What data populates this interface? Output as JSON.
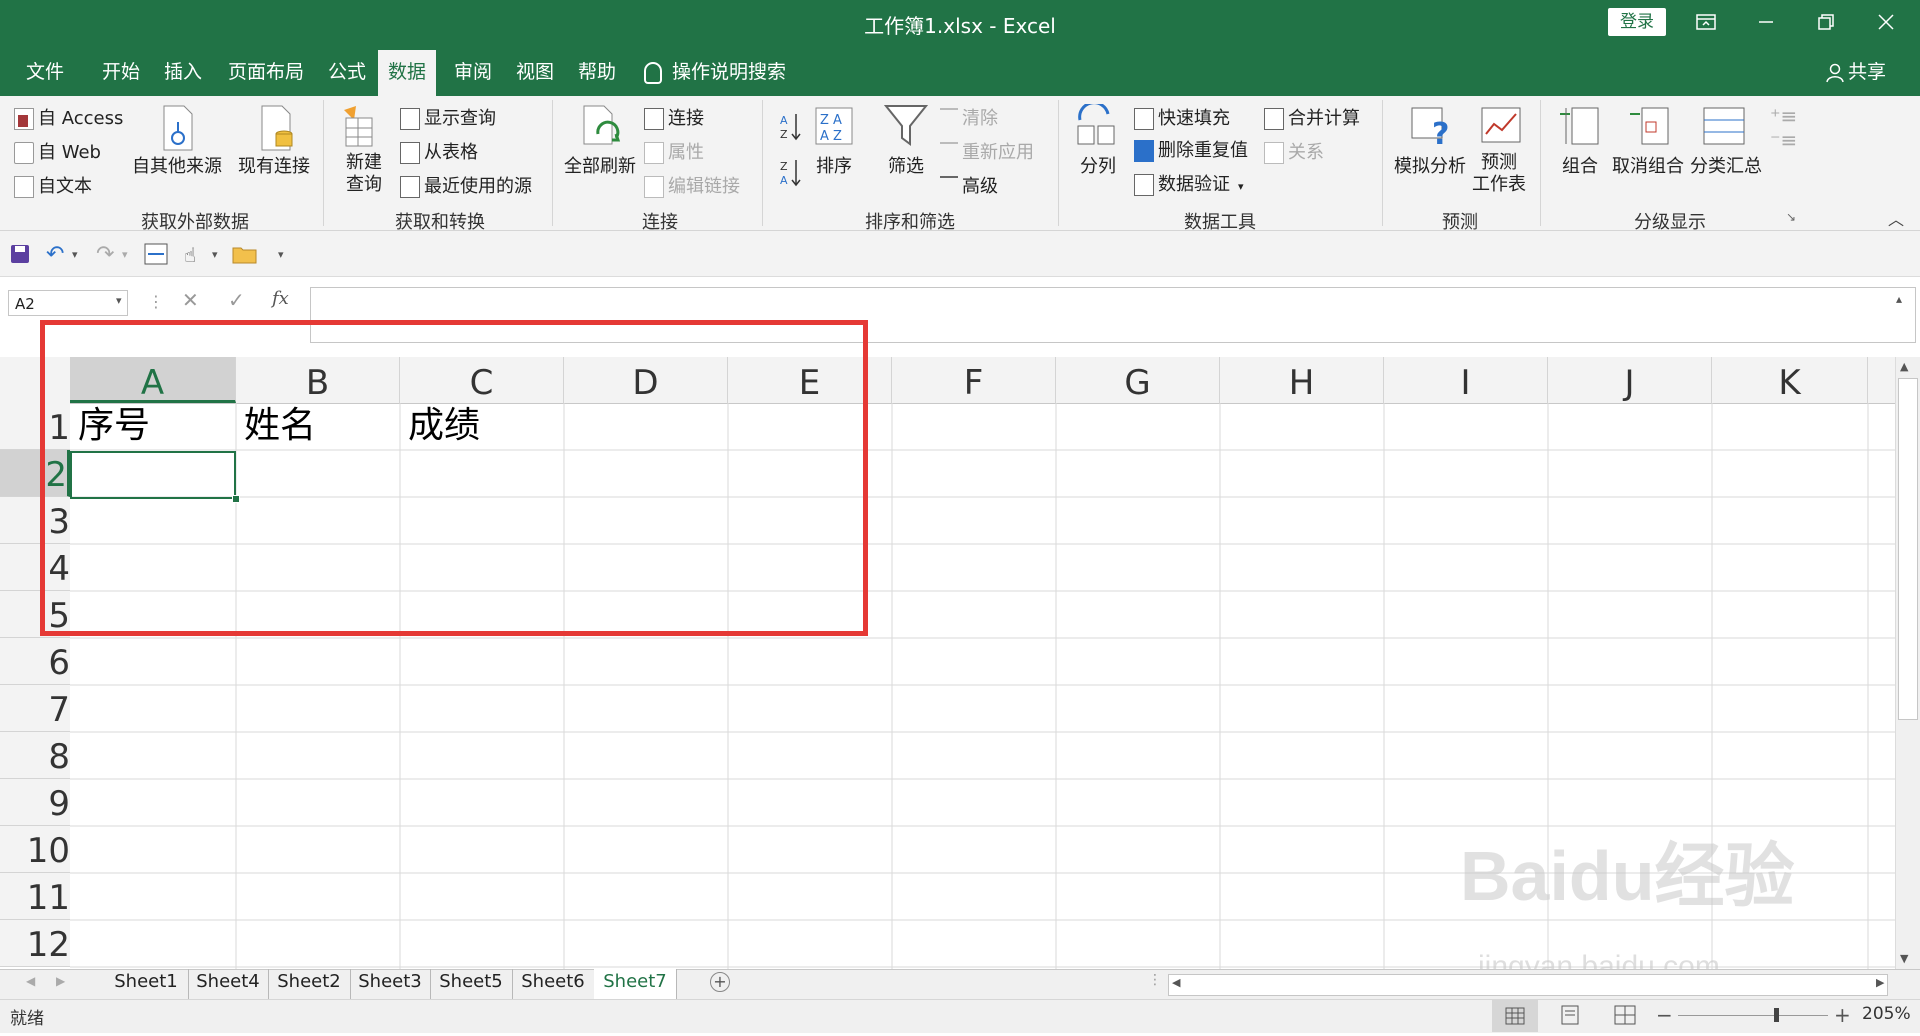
{
  "window": {
    "title": "工作簿1.xlsx  -  Excel",
    "login_label": "登录",
    "share_label": "共享"
  },
  "tabs": [
    "文件",
    "开始",
    "插入",
    "页面布局",
    "公式",
    "数据",
    "审阅",
    "视图",
    "帮助"
  ],
  "active_tab": "数据",
  "tell_me": "操作说明搜索",
  "ribbon": {
    "get_external": {
      "access": "自 Access",
      "web": "自 Web",
      "text": "自文本",
      "other": "自其他来源",
      "existing": "现有连接",
      "label": "获取外部数据"
    },
    "get_transform": {
      "new_query": "新建\n查询",
      "show_queries": "显示查询",
      "from_table": "从表格",
      "recent_sources": "最近使用的源",
      "label": "获取和转换"
    },
    "connections": {
      "refresh_all": "全部刷新",
      "connections": "连接",
      "properties": "属性",
      "edit_links": "编辑链接",
      "label": "连接"
    },
    "sort_filter": {
      "sort": "排序",
      "filter": "筛选",
      "clear": "清除",
      "reapply": "重新应用",
      "advanced": "高级",
      "label": "排序和筛选"
    },
    "data_tools": {
      "text_to_columns": "分列",
      "flash_fill": "快速填充",
      "remove_duplicates": "删除重复值",
      "data_validation": "数据验证",
      "consolidate": "合并计算",
      "relationships": "关系",
      "label": "数据工具"
    },
    "forecast": {
      "what_if": "模拟分析",
      "forecast_sheet": "预测\n工作表",
      "label": "预测"
    },
    "outline": {
      "group": "组合",
      "ungroup": "取消组合",
      "subtotal": "分类汇总",
      "label": "分级显示"
    }
  },
  "name_box": "A2",
  "columns": [
    "A",
    "B",
    "C",
    "D",
    "E",
    "F",
    "G",
    "H",
    "I",
    "J",
    "K"
  ],
  "rows": [
    "1",
    "2",
    "3",
    "4",
    "5",
    "6",
    "7",
    "8",
    "9",
    "10",
    "11",
    "12"
  ],
  "cells": {
    "A1": "序号",
    "B1": "姓名",
    "C1": "成绩"
  },
  "sheets": [
    "Sheet1",
    "Sheet4",
    "Sheet2",
    "Sheet3",
    "Sheet5",
    "Sheet6",
    "Sheet7"
  ],
  "active_sheet": "Sheet7",
  "status": "就绪",
  "zoom": "205%",
  "watermark": {
    "logo": "Baidu经验",
    "url": "jingyan.baidu.com"
  },
  "colors": {
    "excel_green": "#217346",
    "highlight_red": "#e53935"
  }
}
